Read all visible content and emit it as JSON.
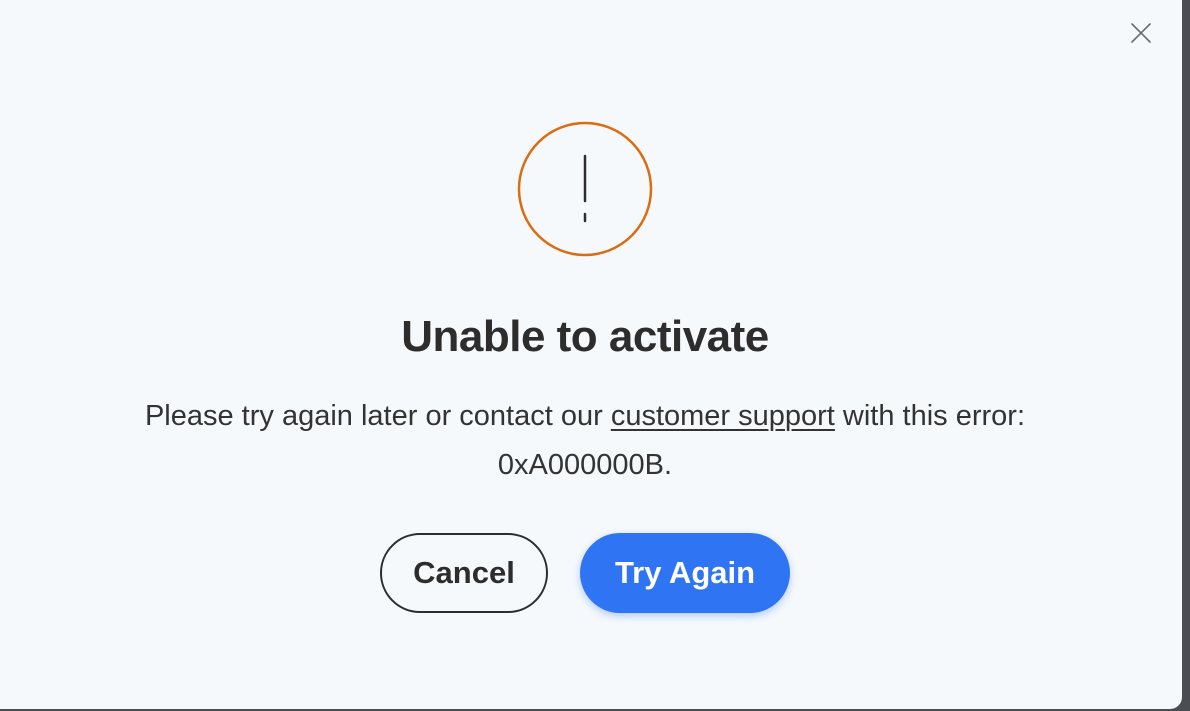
{
  "dialog": {
    "title": "Unable to activate",
    "message_before": "Please try again later or contact our ",
    "link_text": "customer support",
    "message_after": " with this error: 0xA000000B.",
    "close_icon": "close-icon",
    "status_icon": "warning-exclamation-icon",
    "accent_color": "#dd6b10",
    "primary_color": "#2f74f2"
  },
  "buttons": {
    "cancel_label": "Cancel",
    "retry_label": "Try Again"
  }
}
